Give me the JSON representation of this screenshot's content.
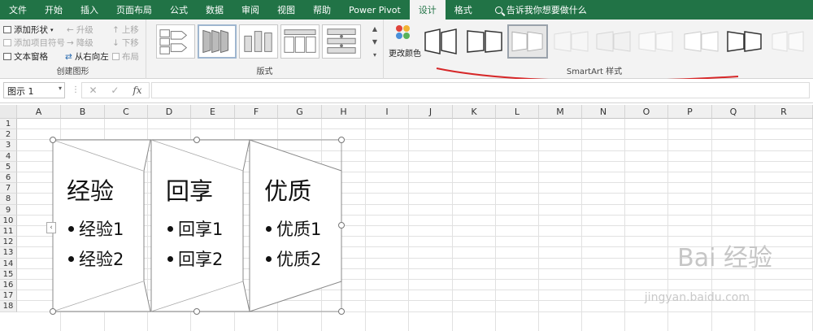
{
  "ribbon_tabs": [
    "文件",
    "开始",
    "插入",
    "页面布局",
    "公式",
    "数据",
    "审阅",
    "视图",
    "帮助",
    "Power Pivot",
    "设计",
    "格式"
  ],
  "active_tab": "设计",
  "tell_me": "告诉我你想要做什么",
  "create_graphic": {
    "label": "创建图形",
    "add_shape": "添加形状",
    "add_bullet": "添加项目符号",
    "text_pane": "文本窗格",
    "promote": "升级",
    "demote": "降级",
    "right_to_left": "从右向左",
    "move_up": "上移",
    "move_down": "下移",
    "layout": "布局"
  },
  "layouts": {
    "label": "版式"
  },
  "smartart_styles": {
    "label": "SmartArt 样式",
    "change_colors": "更改颜色"
  },
  "formula_bar": {
    "name_box": "图示 1",
    "fx": "fx",
    "cancel": "✕",
    "enter": "✓"
  },
  "columns": [
    "A",
    "B",
    "C",
    "D",
    "E",
    "F",
    "G",
    "H",
    "I",
    "J",
    "K",
    "L",
    "M",
    "N",
    "O",
    "P",
    "Q",
    "R"
  ],
  "rows": [
    "1",
    "2",
    "3",
    "4",
    "5",
    "6",
    "7",
    "8",
    "9",
    "10",
    "11",
    "12",
    "13",
    "14",
    "15",
    "16",
    "17",
    "18"
  ],
  "smartart": {
    "panels": [
      {
        "title": "经验",
        "bullets": [
          "经验1",
          "经验2"
        ]
      },
      {
        "title": "回享",
        "bullets": [
          "回享1",
          "回享2"
        ]
      },
      {
        "title": "优质",
        "bullets": [
          "优质1",
          "优质2"
        ]
      }
    ]
  },
  "watermark": {
    "main": "Bai 经验",
    "sub": "jingyan.baidu.com"
  },
  "colors": {
    "ribbon_green": "#217346",
    "annotation_red": "#d62728"
  }
}
